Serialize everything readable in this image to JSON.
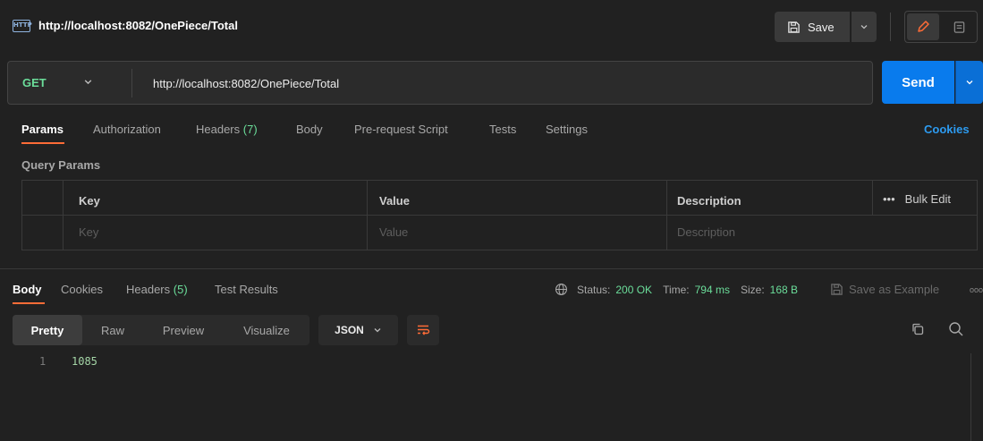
{
  "title": {
    "icon": "http-icon",
    "icon_text": "HTTP",
    "request_name": "http://localhost:8082/OnePiece/Total",
    "save_label": "Save"
  },
  "request": {
    "method": "GET",
    "url": "http://localhost:8082/OnePiece/Total",
    "send_label": "Send"
  },
  "request_tabs": {
    "params": "Params",
    "authorization": "Authorization",
    "headers": "Headers",
    "headers_count": "(7)",
    "body": "Body",
    "prerequest": "Pre-request Script",
    "tests": "Tests",
    "settings": "Settings",
    "cookies": "Cookies"
  },
  "query_params": {
    "label": "Query Params",
    "columns": {
      "key": "Key",
      "value": "Value",
      "description": "Description",
      "bulk_edit": "Bulk Edit",
      "more": "•••"
    },
    "placeholder_row": {
      "key": "Key",
      "value": "Value",
      "description": "Description"
    }
  },
  "response_tabs": {
    "body": "Body",
    "cookies": "Cookies",
    "headers": "Headers",
    "headers_count": "(5)",
    "test_results": "Test Results"
  },
  "response_meta": {
    "status_label": "Status:",
    "status_value": "200 OK",
    "time_label": "Time:",
    "time_value": "794 ms",
    "size_label": "Size:",
    "size_value": "168 B",
    "save_example": "Save as Example",
    "more": "ooo"
  },
  "view": {
    "modes": [
      "Pretty",
      "Raw",
      "Preview",
      "Visualize"
    ],
    "active": "Pretty",
    "format": "JSON"
  },
  "body_lines": [
    {
      "no": "1",
      "text": "1085"
    }
  ],
  "colors": {
    "background": "#212121",
    "accent_orange": "#ff6c37",
    "send_blue": "#097bed",
    "method_green": "#6bdd9a",
    "link_blue": "#2d9bf0"
  }
}
